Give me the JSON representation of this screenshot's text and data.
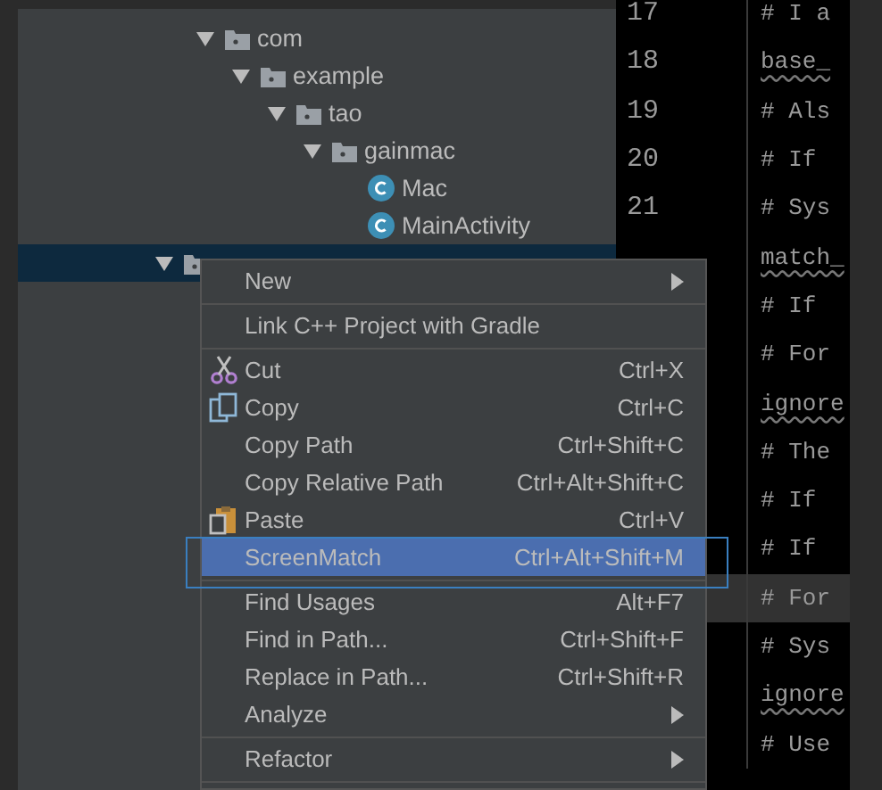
{
  "tree": [
    {
      "kind": "package",
      "label": "com",
      "expanded": true,
      "selected": false,
      "children": [
        {
          "kind": "package",
          "label": "example",
          "expanded": true,
          "selected": false,
          "children": [
            {
              "kind": "package",
              "label": "tao",
              "expanded": true,
              "selected": false,
              "children": [
                {
                  "kind": "package",
                  "label": "gainmac",
                  "expanded": true,
                  "selected": false,
                  "children": [
                    {
                      "kind": "class",
                      "label": "Mac",
                      "selected": false
                    },
                    {
                      "kind": "class",
                      "label": "MainActivity",
                      "selected": false
                    }
                  ]
                }
              ]
            }
          ]
        }
      ]
    },
    {
      "kind": "module",
      "expanded": true,
      "selected": true
    }
  ],
  "editor": {
    "lines": [
      {
        "number": "17",
        "text": "# I a",
        "underlined": false,
        "current": false
      },
      {
        "number": "18",
        "text": "base_",
        "underlined": true,
        "current": false
      },
      {
        "number": "19",
        "text": "# Als",
        "underlined": false,
        "current": false
      },
      {
        "number": "20",
        "text": "# If",
        "underlined": false,
        "current": false
      },
      {
        "number": "21",
        "text": "# Sys",
        "underlined": false,
        "current": false
      },
      {
        "text": "match_",
        "underlined": true,
        "current": false
      },
      {
        "text": "# If",
        "underlined": false,
        "current": false
      },
      {
        "text": "# For",
        "underlined": false,
        "current": false
      },
      {
        "text": "ignore",
        "underlined": true,
        "current": false
      },
      {
        "text": "# The",
        "underlined": false,
        "current": false
      },
      {
        "text": "# If",
        "underlined": false,
        "current": false
      },
      {
        "text": "# If",
        "underlined": false,
        "current": false
      },
      {
        "text": "# For",
        "underlined": false,
        "current": true
      },
      {
        "text": "# Sys",
        "underlined": false,
        "current": false
      },
      {
        "text": "ignore",
        "underlined": true,
        "current": false
      },
      {
        "text": "# Use",
        "underlined": false,
        "current": false
      }
    ]
  },
  "context_menu": {
    "items": [
      {
        "kind": "item",
        "label": "New",
        "submenu": true,
        "selected": false
      },
      {
        "kind": "separator"
      },
      {
        "kind": "item",
        "label": "Link C++ Project with Gradle",
        "selected": false
      },
      {
        "kind": "separator"
      },
      {
        "kind": "item",
        "label": "Cut",
        "shortcut": "Ctrl+X",
        "selected": false
      },
      {
        "kind": "item",
        "label": "Copy",
        "shortcut": "Ctrl+C",
        "selected": false
      },
      {
        "kind": "item",
        "label": "Copy Path",
        "shortcut": "Ctrl+Shift+C",
        "selected": false
      },
      {
        "kind": "item",
        "label": "Copy Relative Path",
        "shortcut": "Ctrl+Alt+Shift+C",
        "selected": false
      },
      {
        "kind": "item",
        "label": "Paste",
        "shortcut": "Ctrl+V",
        "selected": false
      },
      {
        "kind": "item",
        "label": "ScreenMatch",
        "shortcut": "Ctrl+Alt+Shift+M",
        "selected": true,
        "framed": true
      },
      {
        "kind": "separator"
      },
      {
        "kind": "item",
        "label": "Find Usages",
        "shortcut": "Alt+F7",
        "selected": false
      },
      {
        "kind": "item",
        "label": "Find in Path...",
        "shortcut": "Ctrl+Shift+F",
        "selected": false
      },
      {
        "kind": "item",
        "label": "Replace in Path...",
        "shortcut": "Ctrl+Shift+R",
        "selected": false
      },
      {
        "kind": "item",
        "label": "Analyze",
        "submenu": true,
        "selected": false
      },
      {
        "kind": "separator"
      },
      {
        "kind": "item",
        "label": "Refactor",
        "submenu": true,
        "selected": false
      },
      {
        "kind": "separator"
      }
    ]
  }
}
